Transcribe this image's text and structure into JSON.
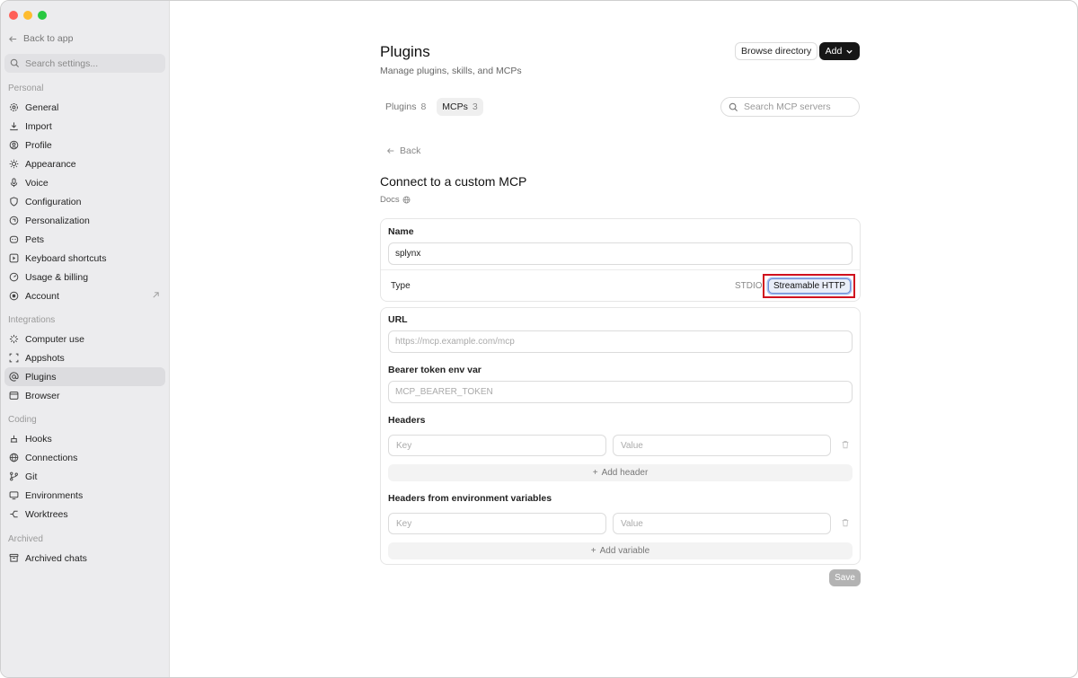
{
  "sidebar": {
    "back_label": "Back to app",
    "search_placeholder": "Search settings...",
    "sections": {
      "personal": "Personal",
      "integrations": "Integrations",
      "coding": "Coding",
      "archived": "Archived"
    },
    "items": {
      "general": "General",
      "import": "Import",
      "profile": "Profile",
      "appearance": "Appearance",
      "voice": "Voice",
      "configuration": "Configuration",
      "personalization": "Personalization",
      "pets": "Pets",
      "keyboard_shortcuts": "Keyboard shortcuts",
      "usage_billing": "Usage & billing",
      "account": "Account",
      "computer_use": "Computer use",
      "appshots": "Appshots",
      "plugins": "Plugins",
      "browser": "Browser",
      "hooks": "Hooks",
      "connections": "Connections",
      "git": "Git",
      "environments": "Environments",
      "worktrees": "Worktrees",
      "archived_chats": "Archived chats"
    },
    "active_item": "plugins"
  },
  "header": {
    "title": "Plugins",
    "subtitle": "Manage plugins, skills, and MCPs",
    "browse_label": "Browse directory",
    "add_label": "Add"
  },
  "tabs": [
    {
      "label": "Plugins",
      "count": "8"
    },
    {
      "label": "MCPs",
      "count": "3"
    }
  ],
  "search_mcp_placeholder": "Search MCP servers",
  "form": {
    "back_label": "Back",
    "title": "Connect to a custom MCP",
    "docs_label": "Docs",
    "name_label": "Name",
    "name_value": "splynx",
    "type_label": "Type",
    "type_options": [
      "STDIO",
      "Streamable HTTP"
    ],
    "type_selected": "Streamable HTTP",
    "url_label": "URL",
    "url_placeholder": "https://mcp.example.com/mcp",
    "bearer_label": "Bearer token env var",
    "bearer_placeholder": "MCP_BEARER_TOKEN",
    "headers_label": "Headers",
    "key_placeholder": "Key",
    "value_placeholder": "Value",
    "add_header_label": "Add header",
    "env_headers_label": "Headers from environment variables",
    "add_variable_label": "Add variable",
    "save_label": "Save"
  },
  "colors": {
    "sidebar_bg": "#ececee",
    "accent_dark": "#161616",
    "highlight": "#d0101e",
    "selected_chip_border": "#6b8cd6"
  }
}
